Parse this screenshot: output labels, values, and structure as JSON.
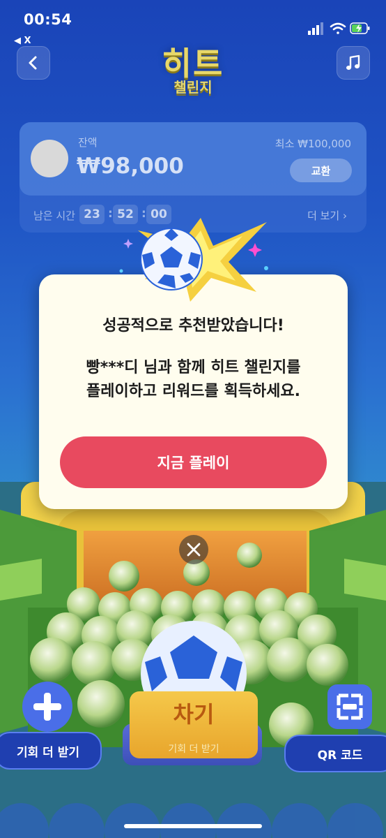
{
  "status_bar": {
    "time": "00:54",
    "back_app": "◀ X"
  },
  "header": {
    "back_icon": "chevron-left-icon",
    "music_icon": "music-note-icon",
    "logo_main": "히트",
    "logo_sub": "챌린지"
  },
  "balance": {
    "label": "잔액",
    "value": "₩98,000",
    "min_label": "최소  ₩100,000",
    "exchange_label": "교환"
  },
  "timer": {
    "label": "남은 시간",
    "hours": "23",
    "minutes": "52",
    "seconds": "00",
    "separator": ":",
    "more_label": "더 보기 ›"
  },
  "modal": {
    "title": "성공적으로 추천받았습니다!",
    "body_line1": "빵***디 님과 함께 히트 챌린지를",
    "body_line2": "플레이하고 리워드를 획득하세요.",
    "play_label": "지금 플레이"
  },
  "bottom": {
    "more_chance_label": "기회 더 받기",
    "kick_label": "차기",
    "kick_sub": "기회 더 받기",
    "qr_label": "QR 코드"
  },
  "colors": {
    "accent_red": "#e84a5f",
    "logo_yellow": "#e8d86a",
    "modal_bg": "#fffdee",
    "button_blue": "#1f3fb0"
  }
}
